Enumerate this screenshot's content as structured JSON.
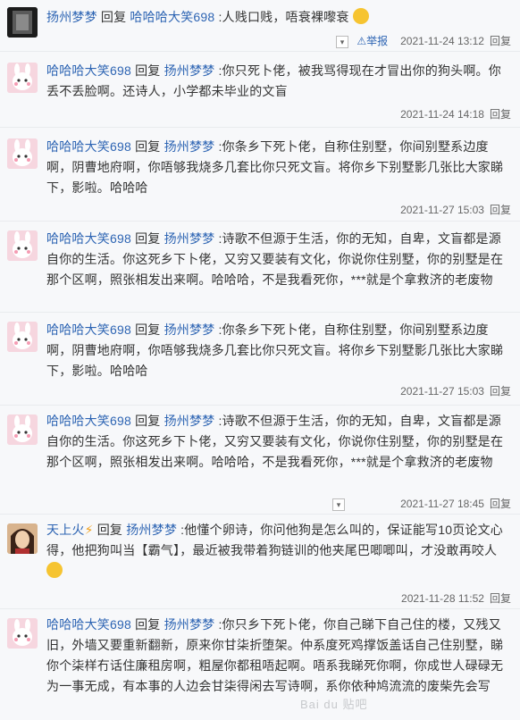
{
  "replies": [
    {
      "author": "扬州梦梦",
      "reply_word": "回复",
      "target": "哈哈哈大笑698",
      "text": " :人贱口贱，唔衰裸嚟衰",
      "report": "举报",
      "time": "2021-11-24 13:12",
      "reply_btn": "回复"
    },
    {
      "author": "哈哈哈大笑698",
      "reply_word": "回复",
      "target": "扬州梦梦",
      "text": " :你只死卜佬，被我骂得现在才冒出你的狗头啊。你丢不丢脸啊。还诗人，小学都未毕业的文盲",
      "time": "2021-11-24 14:18",
      "reply_btn": "回复"
    },
    {
      "author": "哈哈哈大笑698",
      "reply_word": "回复",
      "target": "扬州梦梦",
      "text": " :你条乡下死卜佬，自称住别墅，你间别墅系边度啊，阴曹地府啊，你唔够我烧多几套比你只死文盲。将你乡下别墅影几张比大家睇下，影啦。哈哈哈",
      "time": "2021-11-27 15:03",
      "reply_btn": "回复"
    },
    {
      "author": "哈哈哈大笑698",
      "reply_word": "回复",
      "target": "扬州梦梦",
      "text": " :诗歌不但源于生活，你的无知，自卑，文盲都是源自你的生活。你这死乡下卜佬，又穷又要装有文化，你说你住别墅，你的别墅是在那个区啊，照张相发出来啊。哈哈哈，不是我看死你，***就是个拿救济的老废物",
      "time": "",
      "reply_btn": ""
    },
    {
      "author": "哈哈哈大笑698",
      "reply_word": "回复",
      "target": "扬州梦梦",
      "text": " :你条乡下死卜佬，自称住别墅，你间别墅系边度啊，阴曹地府啊，你唔够我烧多几套比你只死文盲。将你乡下别墅影几张比大家睇下，影啦。哈哈哈",
      "time": "2021-11-27 15:03",
      "reply_btn": "回复"
    },
    {
      "author": "哈哈哈大笑698",
      "reply_word": "回复",
      "target": "扬州梦梦",
      "text": " :诗歌不但源于生活，你的无知，自卑，文盲都是源自你的生活。你这死乡下卜佬，又穷又要装有文化，你说你住别墅，你的别墅是在那个区啊，照张相发出来啊。哈哈哈，不是我看死你，***就是个拿救济的老废物",
      "time": "2021-11-27 18:45",
      "reply_btn": "回复"
    },
    {
      "author": "天上火",
      "reply_word": "回复",
      "target": "扬州梦梦",
      "text": " :他懂个卵诗，你问他狗是怎么叫的，保证能写10页论文心得，他把狗叫当【霸气】，最近被我带着狗链训的他夹尾巴唧唧叫，才没敢再咬人",
      "time": "2021-11-28 11:52",
      "reply_btn": "回复"
    },
    {
      "author": "哈哈哈大笑698",
      "reply_word": "回复",
      "target": "扬州梦梦",
      "text": " :你只乡下死卜佬，你自己睇下自己住的楼，又残又旧，外墙又要重新翻新，原来你甘柒折堕架。仲系度死鸡撑饭盖话自己住别墅，睇你个柒样冇话住廉租房啊，粗屋你都租唔起啊。唔系我睇死你啊，你成世人碌碌无为一事无成，有本事的人边会甘柒得闲去写诗啊，系你依种鸠流流的废柴先会写",
      "time": "",
      "reply_btn": ""
    }
  ],
  "watermark": "Bai du 贴吧",
  "colors": {
    "link": "#2d64b3",
    "text": "#333333",
    "meta": "#666666",
    "bg": "#f7f8fa"
  }
}
